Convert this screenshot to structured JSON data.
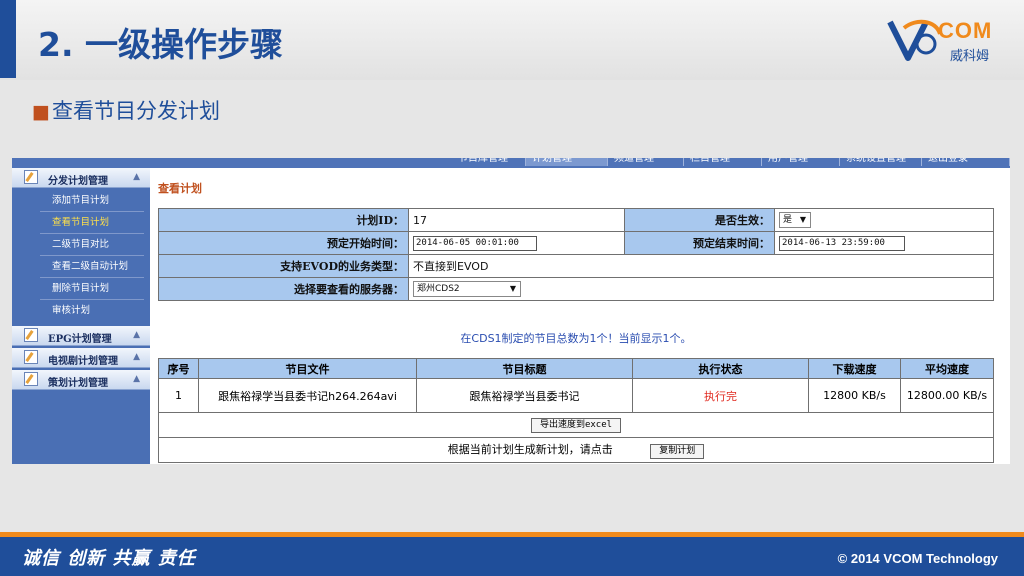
{
  "slide": {
    "title": "2. 一级操作步骤",
    "subtitle": "查看节目分发计划",
    "logo_text": "COM",
    "logo_cn": "威科姆"
  },
  "topnav": {
    "tabs": [
      "节目库管理",
      "计划管理",
      "频道管理",
      "栏目管理",
      "用户管理",
      "系统设置管理",
      "退出登录"
    ],
    "active_index": 1
  },
  "sidebar": {
    "groups": [
      {
        "label": "分发计划管理",
        "items": [
          "添加节目计划",
          "查看节目计划",
          "二级节目对比",
          "查看二级自动计划",
          "删除节目计划",
          "审核计划"
        ],
        "active_item": 1
      },
      {
        "label": "EPG计划管理"
      },
      {
        "label": "电视剧计划管理"
      },
      {
        "label": "策划计划管理"
      }
    ]
  },
  "content": {
    "page_title": "查看计划",
    "info": {
      "plan_id_label": "计划ID：",
      "plan_id": "17",
      "active_label": "是否生效：",
      "active_value": "是",
      "start_label": "预定开始时间：",
      "start_value": "2014-06-05 00:01:00",
      "end_label": "预定结束时间：",
      "end_value": "2014-06-13 23:59:00",
      "evod_label": "支持EVOD的业务类型：",
      "evod_value": "不直接到EVOD",
      "server_label": "选择要查看的服务器：",
      "server_value": "郑州CDS2"
    },
    "summary": "在CDS1制定的节目总数为1个！当前显示1个。",
    "table": {
      "headers": [
        "序号",
        "节目文件",
        "节目标题",
        "执行状态",
        "下载速度",
        "平均速度"
      ],
      "rows": [
        {
          "no": "1",
          "file": "跟焦裕禄学当县委书记h264.264avi",
          "title": "跟焦裕禄学当县委书记",
          "status": "执行完",
          "speed": "12800 KB/s",
          "avg": "12800.00 KB/s"
        }
      ]
    },
    "export_button": "导出速度到excel",
    "regen_text": "根据当前计划生成新计划，请点击",
    "copy_button": "复制计划"
  },
  "footer": {
    "slogan": "诚信 创新 共赢  责任",
    "copyright": "© 2014 VCOM Technology"
  },
  "colors": {
    "brand_blue": "#1f4e9a",
    "brand_orange": "#f08a1c",
    "header_cell": "#a8c8ee",
    "status_red": "#e0281e"
  }
}
